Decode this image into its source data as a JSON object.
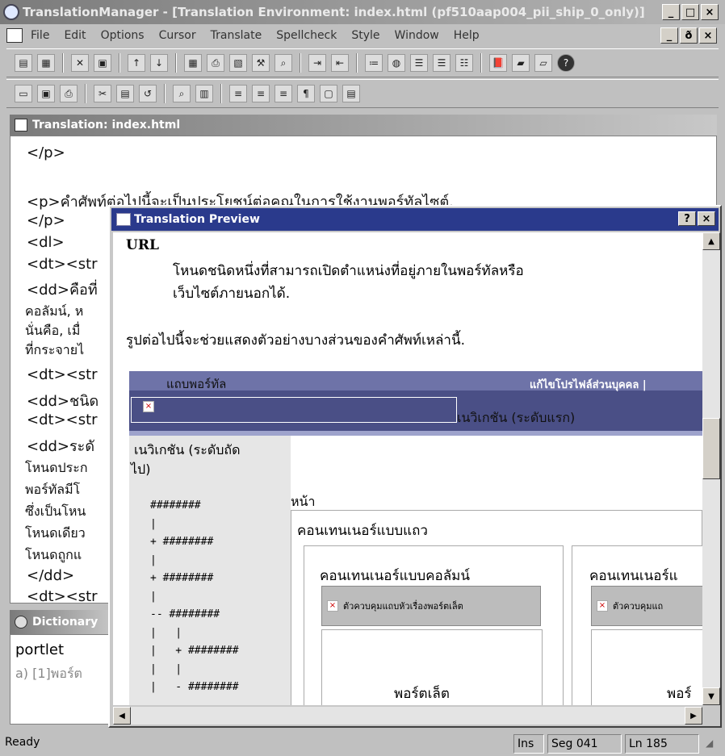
{
  "window": {
    "title": "TranslationManager - [Translation Environment: index.html (pf510aap004_pii_ship_0_only)]",
    "min": "_",
    "max": "□",
    "close": "×"
  },
  "menu": [
    "File",
    "Edit",
    "Options",
    "Cursor",
    "Translate",
    "Spellcheck",
    "Style",
    "Window",
    "Help"
  ],
  "mdi": {
    "min": "_",
    "restore": "ð",
    "close": "×"
  },
  "translation_panel": {
    "title": "Translation: index.html",
    "lines": [
      "</p>",
      "",
      "<p>คำศัพท์ต่อไปนี้จะเป็นประโยชน์ต่อคุณในการใช้งานพอร์ทัลไซต์.",
      "</p>",
      "<dl>",
      "<dt><str",
      "<dd>คือที่",
      "คอลัมน์, ห",
      "นั่นคือ, เมื่",
      "ที่กระจายไ",
      "<dt><str",
      "<dd>ชนิด",
      "<dt><str",
      "<dd>ระดั",
      "โหนดประก",
      "พอร์ทัลมีโ",
      "ซึ่งเป็นโหน",
      "โหนดเดียว",
      "โหนดถูกแ",
      "</dd>",
      "<dt><str"
    ]
  },
  "dictionary_panel": {
    "title": "Dictionary",
    "term": "portlet",
    "entry": "a) [1]พอร์ต"
  },
  "preview": {
    "title": "Translation Preview",
    "help": "?",
    "close": "×",
    "url_term": "URL",
    "url_def_line1": "โหนดชนิดหนึ่งที่สามารถเปิดตำแหน่งที่อยู่ภายในพอร์ทัลหรือ",
    "url_def_line2": "เว็บไซต์ภายนอกได้.",
    "intro": "รูปต่อไปนี้จะช่วยแสดงตัวอย่างบางส่วนของคำศัพท์เหล่านี้.",
    "portal_bar_label": "แถบพอร์ทัล",
    "edit_profile": "แก้ไขโปรไฟล์ส่วนบุคคล |",
    "nav_top": "เนวิเกชัน (ระดับแรก)",
    "nav_next_1": "เนวิเกชัน (ระดับถัด",
    "nav_next_2": "ไป)",
    "tree": [
      "########",
      "|",
      "+ ########",
      "|",
      "+ ########",
      "|",
      "-- ########",
      "|   |",
      "|   + ########",
      "|   |",
      "|   - ########"
    ],
    "page_label": "หน้า",
    "row_container": "คอนเทนเนอร์แบบแถว",
    "col_container_1": "คอนเทนเนอร์แบบคอลัมน์",
    "col_container_2": "คอนเทนเนอร์แ",
    "portlet_head_1": "ตัวควบคุมแถบหัวเรื่องพอร์ตเล็ต",
    "portlet_head_2": "ตัวควบคุมแถ",
    "portlet_1": "พอร์ตเล็ต",
    "portlet_2": "พอร์"
  },
  "status": {
    "ready": "Ready",
    "ins": "Ins",
    "seg": "Seg 041",
    "ln": "Ln 185"
  }
}
